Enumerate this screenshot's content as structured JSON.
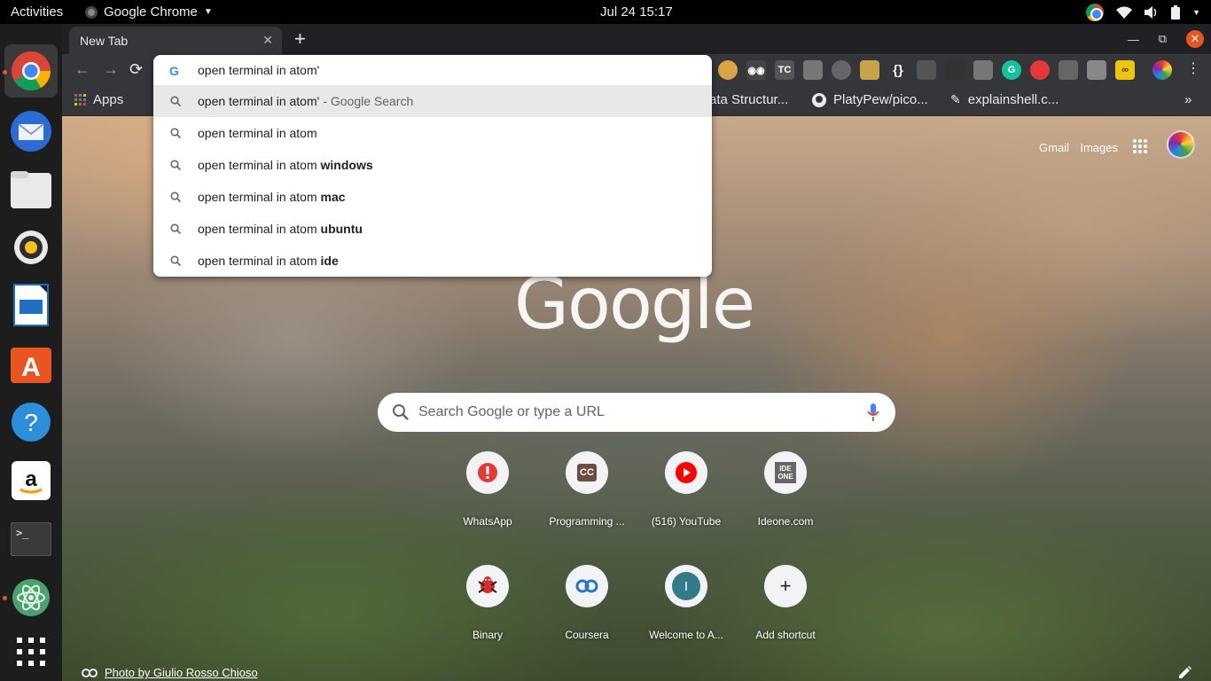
{
  "topbar": {
    "activities": "Activities",
    "app_name": "Google Chrome",
    "clock": "Jul 24  15:17"
  },
  "dock": {
    "items": [
      {
        "name": "chrome",
        "icon": "chrome-icon"
      },
      {
        "name": "thunderbird",
        "icon": "mail-icon"
      },
      {
        "name": "files",
        "icon": "folder-icon"
      },
      {
        "name": "rhythmbox",
        "icon": "speaker-icon"
      },
      {
        "name": "writer",
        "icon": "document-icon"
      },
      {
        "name": "software",
        "icon": "software-store-icon"
      },
      {
        "name": "help",
        "icon": "help-icon"
      },
      {
        "name": "amazon",
        "icon": "amazon-icon"
      },
      {
        "name": "terminal",
        "icon": "terminal-icon"
      },
      {
        "name": "atom",
        "icon": "atom-icon"
      },
      {
        "name": "show-apps",
        "icon": "grid-icon"
      }
    ]
  },
  "browser": {
    "tab_title": "New Tab",
    "bookmarks": [
      {
        "label": "Apps"
      },
      {
        "label": "ata Structur..."
      },
      {
        "label": "PlatyPew/pico..."
      },
      {
        "label": "explainshell.c..."
      }
    ]
  },
  "omnibox": {
    "input_value": "open terminal in atom'",
    "suggestions": [
      {
        "base": "open terminal in atom'",
        "bold": "",
        "suffix": "- Google Search"
      },
      {
        "base": "open terminal in atom",
        "bold": "",
        "suffix": ""
      },
      {
        "base": "open terminal in atom ",
        "bold": "windows",
        "suffix": ""
      },
      {
        "base": "open terminal in atom ",
        "bold": "mac",
        "suffix": ""
      },
      {
        "base": "open terminal in atom ",
        "bold": "ubuntu",
        "suffix": ""
      },
      {
        "base": "open terminal in atom ",
        "bold": "ide",
        "suffix": ""
      }
    ]
  },
  "ntp": {
    "gmail": "Gmail",
    "images": "Images",
    "logo": "Google",
    "search_placeholder": "Search Google or type a URL",
    "shortcuts": [
      {
        "label": "WhatsApp",
        "icon": "whatsapp-icon"
      },
      {
        "label": "Programming ...",
        "icon": "cc-icon",
        "glyph": "CC"
      },
      {
        "label": "(516) YouTube",
        "icon": "youtube-icon"
      },
      {
        "label": "Ideone.com",
        "icon": "ideone-icon",
        "glyph": "IDE ONE"
      },
      {
        "label": "Binary",
        "icon": "binary-icon"
      },
      {
        "label": "Coursera",
        "icon": "coursera-icon"
      },
      {
        "label": "Welcome to A...",
        "icon": "letter-avatar-icon",
        "glyph": "I"
      },
      {
        "label": "Add shortcut",
        "icon": "plus-icon",
        "glyph": "+"
      }
    ],
    "photo_credit": "Photo by Giulio Rosso Chioso"
  },
  "colors": {
    "ubuntu_orange": "#e95420",
    "chrome_dark": "#35363a",
    "tabstrip": "#202124"
  }
}
